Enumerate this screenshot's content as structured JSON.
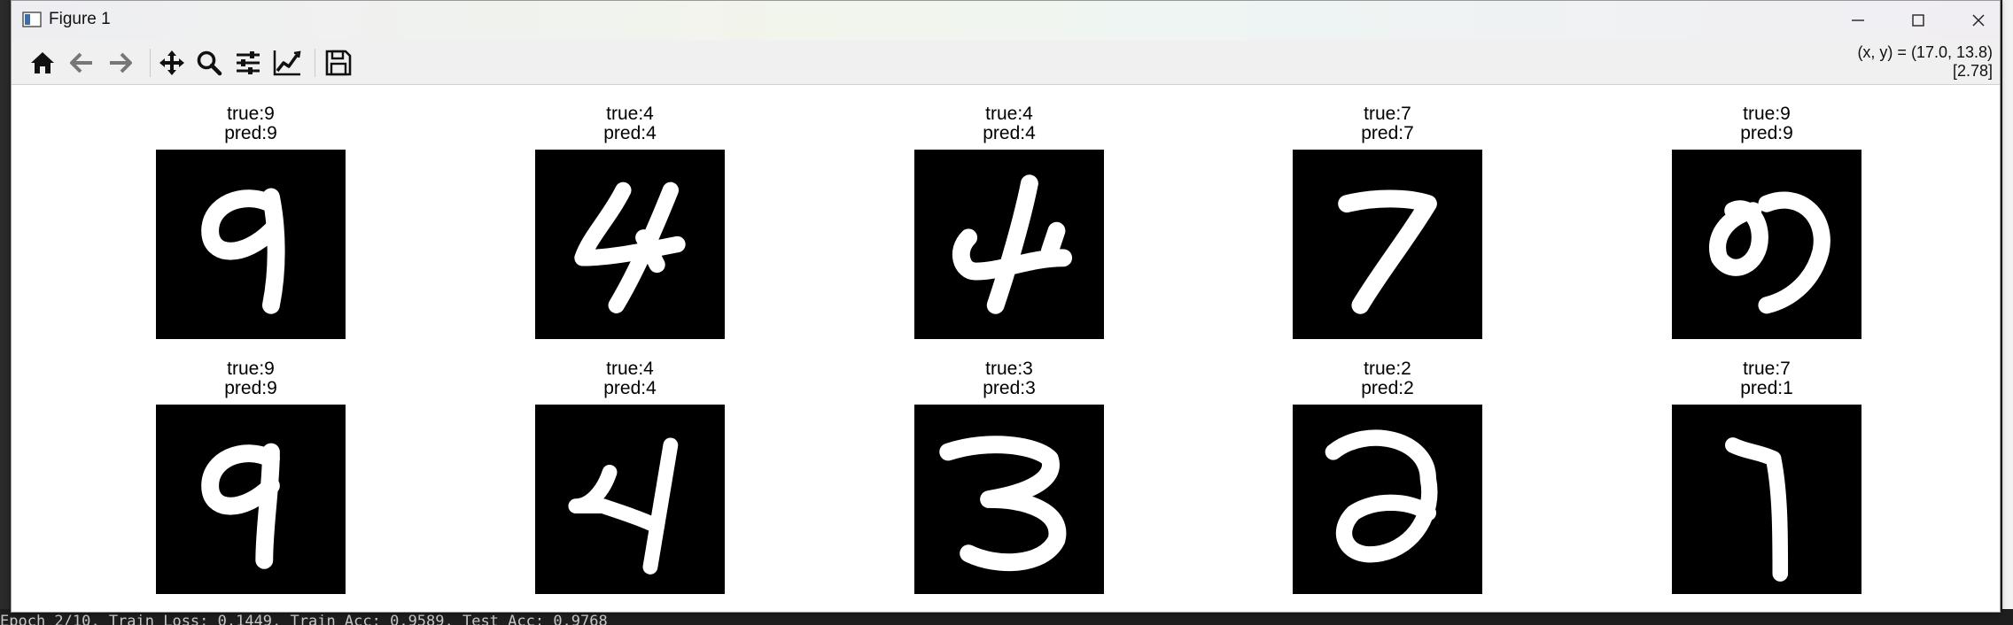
{
  "window": {
    "title": "Figure 1"
  },
  "toolbar": {
    "buttons": [
      {
        "name": "home-button",
        "icon": "home-icon"
      },
      {
        "name": "back-button",
        "icon": "arrow-left-icon"
      },
      {
        "name": "forward-button",
        "icon": "arrow-right-icon"
      },
      {
        "name": "pan-button",
        "icon": "move-icon"
      },
      {
        "name": "zoom-button",
        "icon": "magnifier-icon"
      },
      {
        "name": "subplots-button",
        "icon": "sliders-icon"
      },
      {
        "name": "axes-edit-button",
        "icon": "line-chart-icon"
      },
      {
        "name": "save-button",
        "icon": "floppy-disk-icon"
      }
    ],
    "coords_line1": "(x, y) = (17.0, 13.8)",
    "coords_line2": "[2.78]"
  },
  "plots": [
    {
      "true_label": "true:9",
      "pred_label": "pred:9"
    },
    {
      "true_label": "true:4",
      "pred_label": "pred:4"
    },
    {
      "true_label": "true:4",
      "pred_label": "pred:4"
    },
    {
      "true_label": "true:7",
      "pred_label": "pred:7"
    },
    {
      "true_label": "true:9",
      "pred_label": "pred:9"
    },
    {
      "true_label": "true:9",
      "pred_label": "pred:9"
    },
    {
      "true_label": "true:4",
      "pred_label": "pred:4"
    },
    {
      "true_label": "true:3",
      "pred_label": "pred:3"
    },
    {
      "true_label": "true:2",
      "pred_label": "pred:2"
    },
    {
      "true_label": "true:7",
      "pred_label": "pred:1"
    }
  ],
  "console": {
    "text": "Epoch 2/10, Train Loss: 0.1449, Train Acc: 0.9589, Test Acc: 0.9768"
  },
  "colors": {
    "image_bg": "#000000",
    "stroke": "#ffffff",
    "toolbar_bg": "#f0f0f0"
  }
}
